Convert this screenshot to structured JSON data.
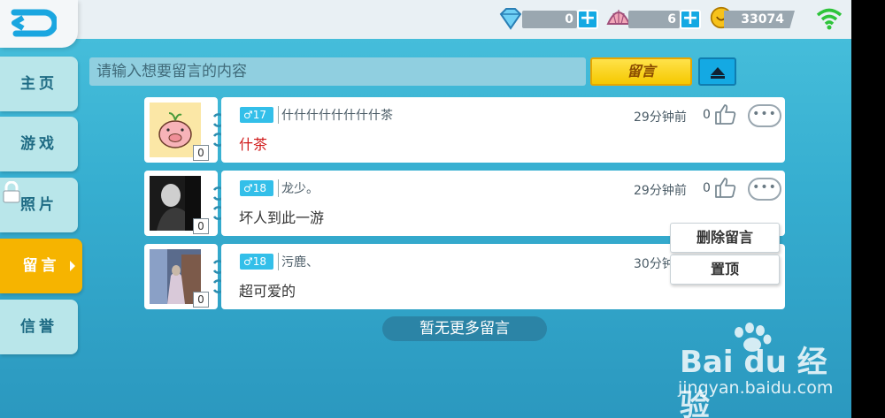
{
  "resources": {
    "diamonds": "0",
    "shells": "6",
    "coins": "33074"
  },
  "sidebar": {
    "items": [
      {
        "label": "主页",
        "active": false
      },
      {
        "label": "游戏",
        "active": false
      },
      {
        "label": "照片",
        "active": false,
        "locked": true
      },
      {
        "label": "留言",
        "active": true
      },
      {
        "label": "信誉",
        "active": false
      }
    ]
  },
  "compose": {
    "placeholder": "请输入想要留言的内容",
    "post_label": "留言"
  },
  "messages": [
    {
      "avatar_count": "0",
      "gender": "♂",
      "level": "17",
      "username": "什什什什什什什什茶",
      "text": "什茶",
      "text_color": "#d01818",
      "time": "29分钟前",
      "likes": "0"
    },
    {
      "avatar_count": "0",
      "gender": "♂",
      "level": "18",
      "username": "龙少。",
      "text": "坏人到此一游",
      "time": "29分钟前",
      "likes": "0"
    },
    {
      "avatar_count": "0",
      "gender": "♂",
      "level": "18",
      "username": "污鹿、",
      "text": "超可爱的",
      "time": "30分钟"
    }
  ],
  "context_menu": {
    "delete_label": "删除留言",
    "pin_label": "置顶"
  },
  "footer": {
    "no_more": "暂无更多留言"
  },
  "watermark": {
    "brand": "Bai du 经验",
    "url": "jingyan.baidu.com"
  },
  "colors": {
    "accent": "#f6b400",
    "primary": "#14a9e3",
    "background": "#3bb4d4"
  }
}
